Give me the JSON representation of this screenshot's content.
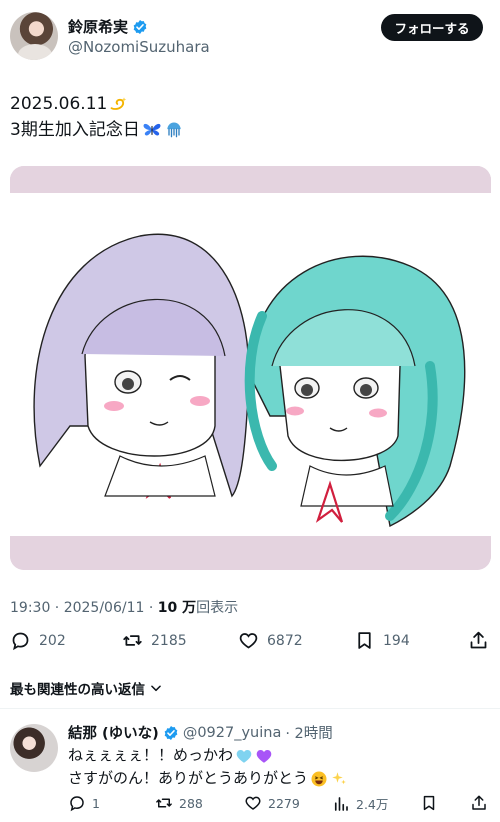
{
  "post": {
    "display_name": "鈴原希実",
    "handle": "@NozomiSuzuhara",
    "follow_label": "フォローする",
    "text_line1": "2025.06.11",
    "text_line2": "3期生加入記念日",
    "timestamp": "19:30 · 2025/06/11 · ",
    "views_count": "10 万",
    "views_label": "回表示",
    "replies": "202",
    "reposts": "2185",
    "likes": "6872",
    "bookmarks": "194"
  },
  "sort_label": "最も関連性の高い返信",
  "reply": {
    "name": "結那 (ゆいな)",
    "handle": "@0927_yuina",
    "time": "· 2時間",
    "line1": "ねぇぇぇぇ！！めっかわ",
    "line2": "さすがのん！ありがとうありがとう",
    "replies": "1",
    "reposts": "288",
    "likes": "2279",
    "views": "2.4万"
  },
  "colors": {
    "verified": "#1d9bf0",
    "media_bg": "#e4d3df",
    "follow_button": "#0f1419",
    "secondary_text": "#536471"
  },
  "icons": [
    "verified-badge-icon",
    "dizzy-emoji-icon",
    "butterfly-emoji-icon",
    "jellyfish-emoji-icon",
    "reply-icon",
    "repost-icon",
    "like-icon",
    "bookmark-icon",
    "share-icon",
    "chevron-down-icon",
    "views-icon",
    "light-blue-heart-emoji-icon",
    "purple-heart-emoji-icon",
    "laughing-emoji-icon",
    "sparkles-emoji-icon"
  ]
}
